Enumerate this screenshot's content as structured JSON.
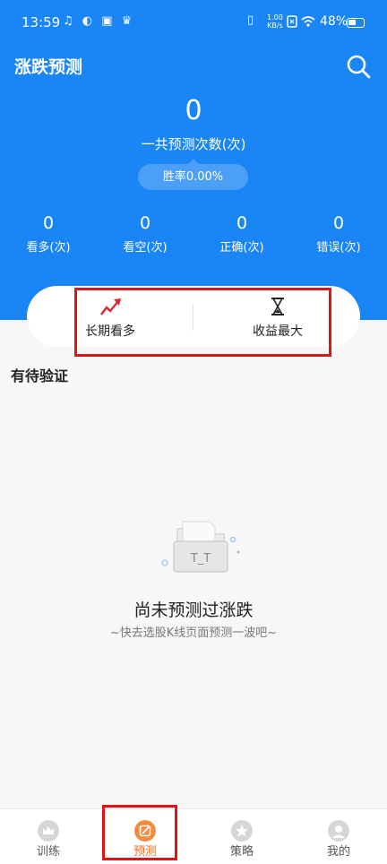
{
  "status_bar": {
    "time": "13:59",
    "app_icons": "♫ ◐ ▣ ♛",
    "net_speed_value": "1.00",
    "net_speed_unit": "KB/s",
    "battery_percent": "48%"
  },
  "header": {
    "title": "涨跌预测",
    "total_count": "0",
    "total_label": "一共预测次数(次)",
    "win_rate": "胜率0.00%"
  },
  "stats": [
    {
      "value": "0",
      "label": "看多(次)"
    },
    {
      "value": "0",
      "label": "看空(次)"
    },
    {
      "value": "0",
      "label": "正确(次)"
    },
    {
      "value": "0",
      "label": "错误(次)"
    }
  ],
  "strategies": [
    {
      "label": "长期看多",
      "icon": "trend-up-icon"
    },
    {
      "label": "收益最大",
      "icon": "hourglass-icon"
    }
  ],
  "section": {
    "title": "有待验证"
  },
  "empty_state": {
    "title": "尚未预测过涨跌",
    "subtitle": "~快去选股K线页面预测一波吧~"
  },
  "tabs": [
    {
      "label": "训练",
      "icon": "crown-icon"
    },
    {
      "label": "预测",
      "icon": "edit-icon",
      "active": true
    },
    {
      "label": "策略",
      "icon": "star-icon"
    },
    {
      "label": "我的",
      "icon": "user-icon"
    }
  ],
  "colors": {
    "primary": "#1a85f5",
    "active_tab": "#f16b1e",
    "highlight_box": "#e01414"
  }
}
